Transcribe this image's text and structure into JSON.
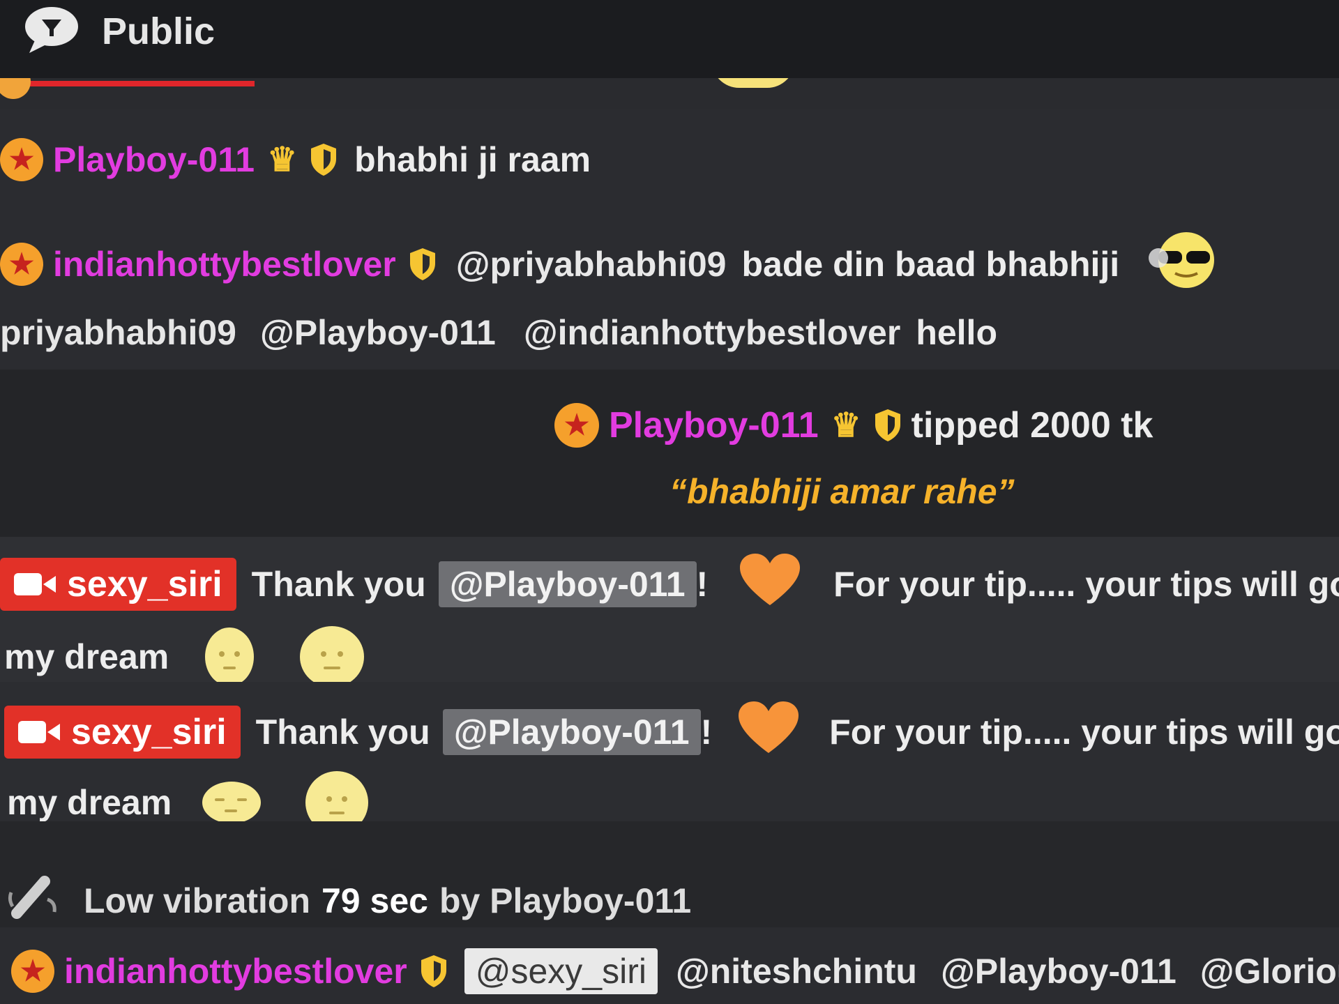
{
  "header": {
    "title": "Public",
    "icon": "chat-bubble-icon"
  },
  "messages": {
    "m1": {
      "username": "Playboy-011",
      "text": "bhabhi ji raam"
    },
    "m2": {
      "username": "indianhottybestlover",
      "mention": "@priyabhabhi09",
      "text": "bade din baad bhabhiji"
    },
    "m3": {
      "username": "priyabhabhi09",
      "mention1": "@Playboy-011",
      "mention2": "@indianhottybestlover",
      "text": "hello"
    },
    "tip": {
      "username": "Playboy-011",
      "text": "tipped 2000 tk",
      "note": "“bhabhiji amar rahe”"
    },
    "thanks1": {
      "model": "sexy_siri",
      "prefix": "Thank you",
      "mention": "@Playboy-011",
      "bang": "!",
      "text": "For your tip..... your tips will gonn",
      "cont": "my dream"
    },
    "thanks2": {
      "model": "sexy_siri",
      "prefix": "Thank you",
      "mention": "@Playboy-011",
      "bang": "!",
      "text": "For your tip..... your tips will gonna",
      "cont": "my dream"
    },
    "vibe": {
      "pre": "Low vibration",
      "duration": "79 sec",
      "post": "by Playboy-011"
    },
    "last": {
      "username": "indianhottybestlover",
      "mention1": "@sexy_siri",
      "mention2": "@niteshchintu",
      "mention3": "@Playboy-011",
      "mention4": "@Glorious_"
    }
  },
  "colors": {
    "background": "#1f2023",
    "username": "#e23ce0",
    "model_badge": "#e23128",
    "tip_note": "#f6b22a",
    "badge": "#f5a02c"
  }
}
